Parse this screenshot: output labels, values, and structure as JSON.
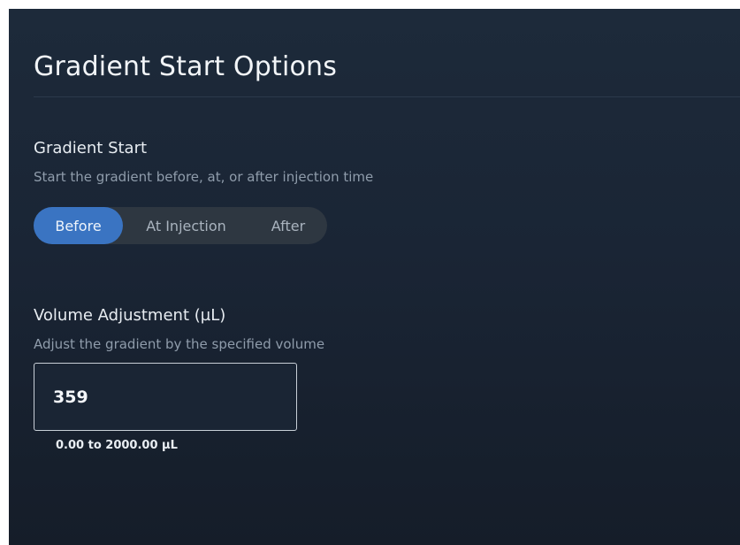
{
  "panel": {
    "title": "Gradient Start Options"
  },
  "gradient_start": {
    "label": "Gradient Start",
    "description": "Start the gradient before, at, or after injection time",
    "options": [
      {
        "label": "Before",
        "selected": true
      },
      {
        "label": "At Injection",
        "selected": false
      },
      {
        "label": "After",
        "selected": false
      }
    ]
  },
  "volume_adjustment": {
    "label": "Volume Adjustment (µL)",
    "description": "Adjust the gradient by the specified volume",
    "value": "359",
    "range_hint": "0.00 to 2000.00 µL"
  },
  "colors": {
    "panel_background": "#1a2535",
    "accent": "#3a74c2",
    "toggle_track": "#2e3741",
    "muted_text": "#8f9cab"
  }
}
